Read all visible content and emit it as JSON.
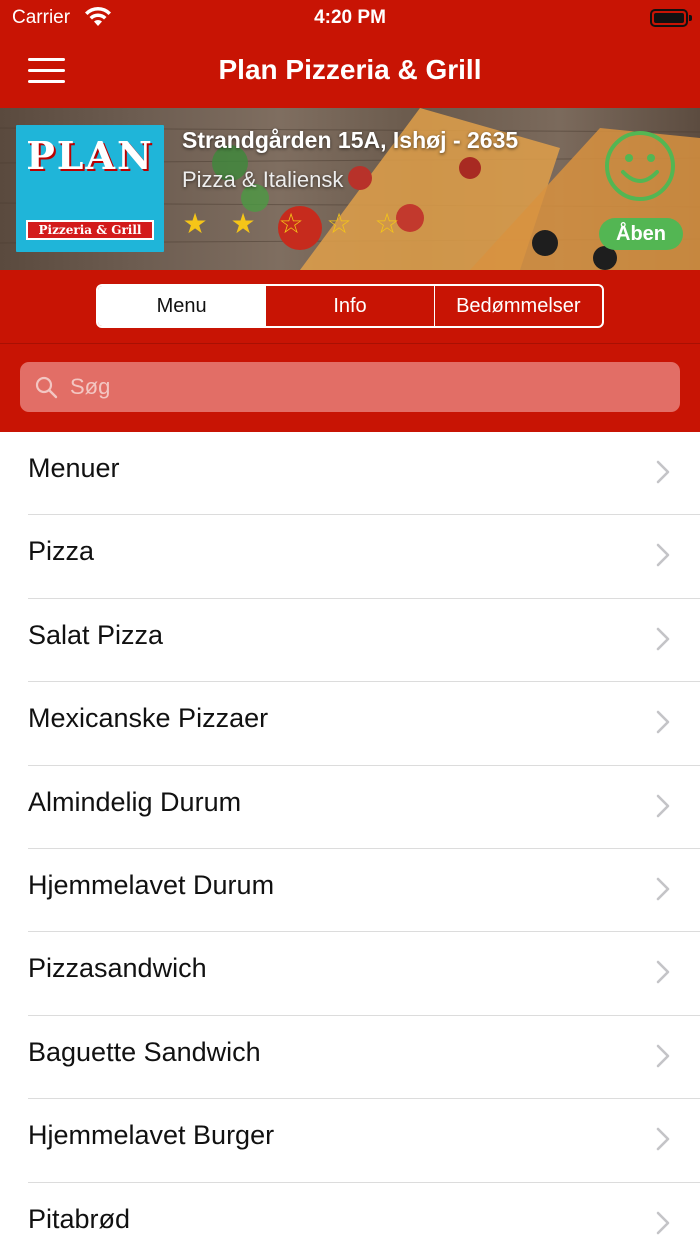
{
  "status_bar": {
    "carrier": "Carrier",
    "time": "4:20 PM"
  },
  "nav": {
    "title": "Plan Pizzeria & Grill",
    "menu_icon": "hamburger-icon"
  },
  "restaurant": {
    "logo_text": "PLAN",
    "logo_subtext": "Pizzeria & Grill",
    "address": "Strandgården 15A, Ishøj - 2635",
    "cuisine": "Pizza & Italiensk",
    "rating": 2,
    "rating_max": 5,
    "status_label": "Åben",
    "status_color": "#53b653",
    "smiley_color": "#53b653"
  },
  "tabs": [
    {
      "label": "Menu",
      "active": true
    },
    {
      "label": "Info",
      "active": false
    },
    {
      "label": "Bedømmelser",
      "active": false
    }
  ],
  "search": {
    "placeholder": "Søg"
  },
  "categories": [
    {
      "label": "Menuer"
    },
    {
      "label": "Pizza"
    },
    {
      "label": "Salat Pizza"
    },
    {
      "label": "Mexicanske Pizzaer"
    },
    {
      "label": "Almindelig Durum"
    },
    {
      "label": "Hjemmelavet Durum"
    },
    {
      "label": "Pizzasandwich"
    },
    {
      "label": "Baguette Sandwich"
    },
    {
      "label": "Hjemmelavet Burger"
    },
    {
      "label": "Pitabrød"
    }
  ],
  "colors": {
    "brand_red": "#c81404",
    "accent_yellow": "#f5c518"
  }
}
